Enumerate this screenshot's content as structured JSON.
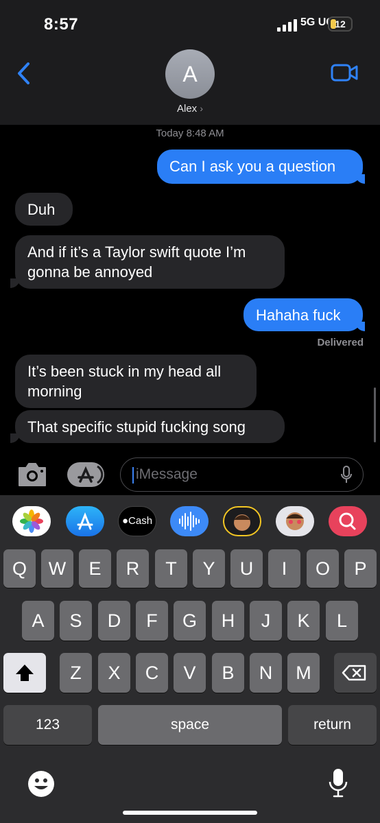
{
  "status_bar": {
    "time": "8:57",
    "network": "5G UC",
    "battery": "12"
  },
  "header": {
    "avatar_initial": "A",
    "contact_name": "Alex"
  },
  "chat": {
    "timestamp": "Today 8:48 AM",
    "messages": [
      {
        "direction": "sent",
        "text": "Can I ask you a question"
      },
      {
        "direction": "received",
        "text": "Duh"
      },
      {
        "direction": "received",
        "text": "And if it’s a Taylor swift quote I’m gonna be annoyed"
      },
      {
        "direction": "sent",
        "text": "Hahaha fuck"
      },
      {
        "direction": "received",
        "text": "It’s been stuck in my head all morning"
      },
      {
        "direction": "received",
        "text": "That specific stupid fucking song"
      }
    ],
    "delivered_label": "Delivered"
  },
  "input": {
    "placeholder": "iMessage"
  },
  "app_tray": {
    "cash_label": "Cash"
  },
  "keyboard": {
    "row1": [
      "Q",
      "W",
      "E",
      "R",
      "T",
      "Y",
      "U",
      "I",
      "O",
      "P"
    ],
    "row2": [
      "A",
      "S",
      "D",
      "F",
      "G",
      "H",
      "J",
      "K",
      "L"
    ],
    "row3": [
      "Z",
      "X",
      "C",
      "V",
      "B",
      "N",
      "M"
    ],
    "numbers_label": "123",
    "space_label": "space",
    "return_label": "return"
  },
  "colors": {
    "sent_bubble": "#2a7ef6",
    "received_bubble": "#262629",
    "accent": "#2f82f7",
    "battery": "#f2c94c"
  }
}
